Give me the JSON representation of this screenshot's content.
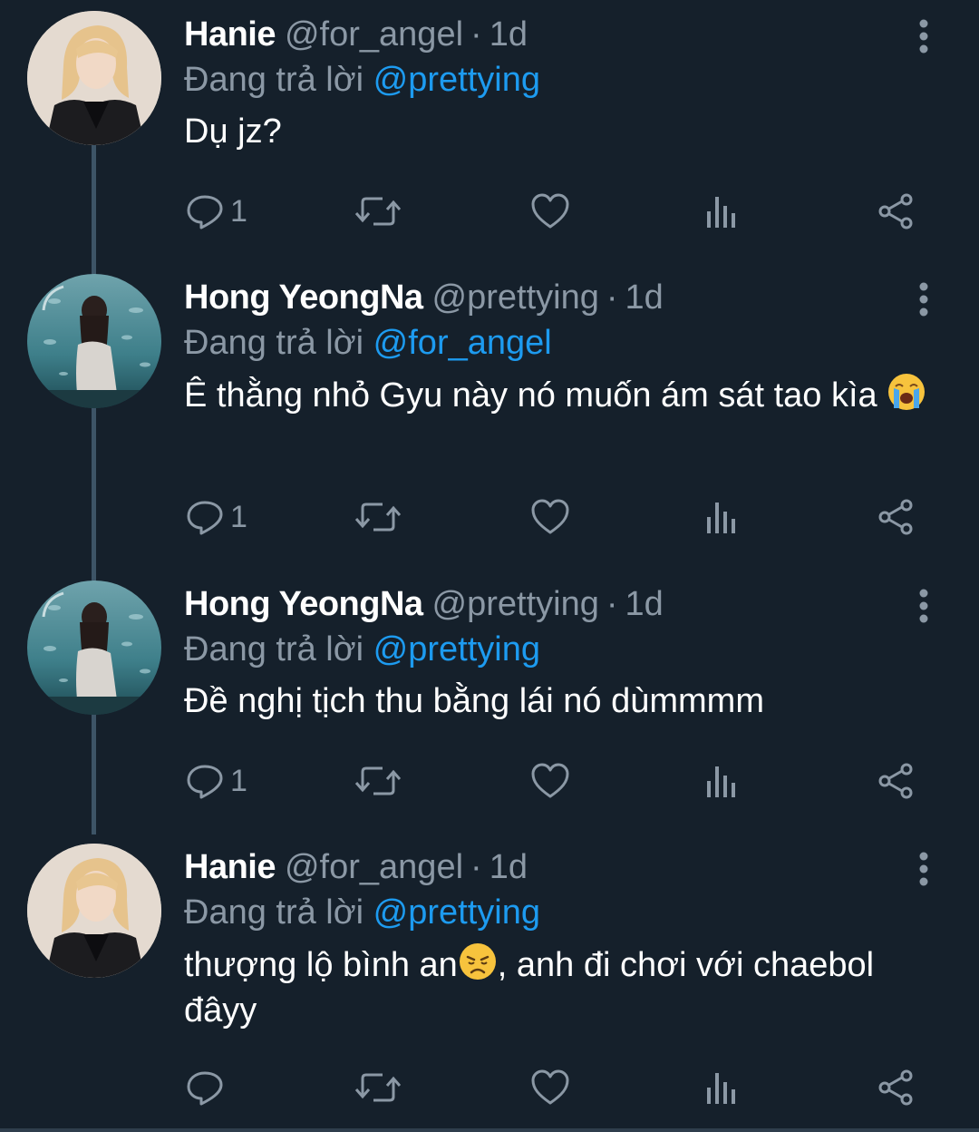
{
  "colors": {
    "background": "#15202b",
    "text_primary": "#ffffff",
    "text_secondary": "#8b98a5",
    "mention": "#1d9bf0",
    "thread_line": "#3d5466"
  },
  "tweets": [
    {
      "display_name": "Hanie",
      "handle": "@for_angel",
      "separator": "·",
      "time": "1d",
      "replying_label": "Đang trả lời",
      "replying_to": "@prettying",
      "text_before_emoji": "Dụ jz?",
      "emoji": "",
      "text_after_emoji": "",
      "reply_count": "1",
      "avatar_icon": "avatar-blonde-person-icon"
    },
    {
      "display_name": "Hong YeongNa",
      "handle": "@prettying",
      "separator": "·",
      "time": "1d",
      "replying_label": "Đang trả lời",
      "replying_to": "@for_angel",
      "text_before_emoji": "Ê thằng nhỏ Gyu này nó muốn ám sát tao kìa ",
      "emoji": "loudly-crying-face-emoji",
      "text_after_emoji": "",
      "reply_count": "1",
      "avatar_icon": "avatar-aquarium-person-icon"
    },
    {
      "display_name": "Hong YeongNa",
      "handle": "@prettying",
      "separator": "·",
      "time": "1d",
      "replying_label": "Đang trả lời",
      "replying_to": "@prettying",
      "text_before_emoji": "Đề nghị tịch thu bằng lái nó dùmmmm",
      "emoji": "",
      "text_after_emoji": "",
      "reply_count": "1",
      "avatar_icon": "avatar-aquarium-person-icon"
    },
    {
      "display_name": "Hanie",
      "handle": "@for_angel",
      "separator": "·",
      "time": "1d",
      "replying_label": "Đang trả lời",
      "replying_to": "@prettying",
      "text_before_emoji": "thượng lộ bình an",
      "emoji": "disappointed-face-emoji",
      "text_after_emoji": ", anh đi chơi với chaebol đâyy",
      "reply_count": "",
      "avatar_icon": "avatar-blonde-person-icon"
    }
  ],
  "action_icons": [
    "reply-icon",
    "retweet-icon",
    "like-icon",
    "analytics-icon",
    "share-icon"
  ]
}
